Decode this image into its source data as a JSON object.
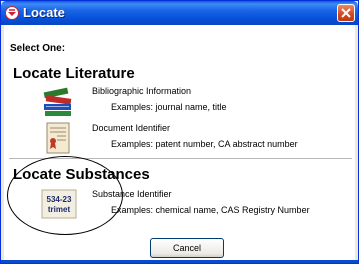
{
  "window": {
    "title": "Locate"
  },
  "dialog": {
    "instruction": "Select One:",
    "cancel_label": "Cancel"
  },
  "literature": {
    "title": "Locate Literature",
    "items": [
      {
        "label": "Bibliographic Information",
        "example": "Examples: journal name, title",
        "icon": "books-icon"
      },
      {
        "label": "Document Identifier",
        "example": "Examples: patent number, CA abstract number",
        "icon": "document-certificate-icon"
      }
    ]
  },
  "substances": {
    "title": "Locate Substances",
    "items": [
      {
        "label": "Substance Identifier",
        "example": "Examples: chemical name, CAS Registry Number",
        "icon": "substance-id-icon",
        "icon_text_top": "534-23",
        "icon_text_bottom": "trimet"
      }
    ]
  },
  "colors": {
    "titlebar": "#0a5ae0",
    "close_button": "#d2461d",
    "window_body": "#ffffff"
  }
}
